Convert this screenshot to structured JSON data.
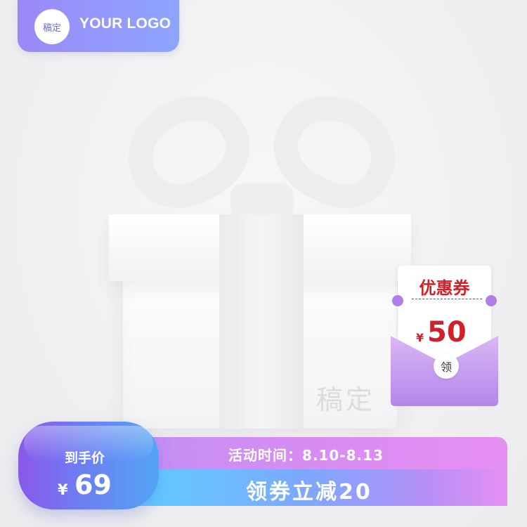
{
  "brand": {
    "logo_mark": "稿定",
    "logo_text": "YOUR LOGO"
  },
  "illustration": {
    "watermark": "稿定",
    "subject": "gift-box"
  },
  "coupon": {
    "title": "优惠券",
    "currency": "¥",
    "amount": "50",
    "claim_label": "领"
  },
  "price": {
    "label": "到手价",
    "currency": "¥",
    "value": "69"
  },
  "banner": {
    "activity_time": "活动时间：8.10-8.13",
    "promo": "领券立减20"
  },
  "colors": {
    "accent_purple": "#8a58ea",
    "accent_blue": "#53a5f5",
    "coupon_red": "#d0202a"
  }
}
